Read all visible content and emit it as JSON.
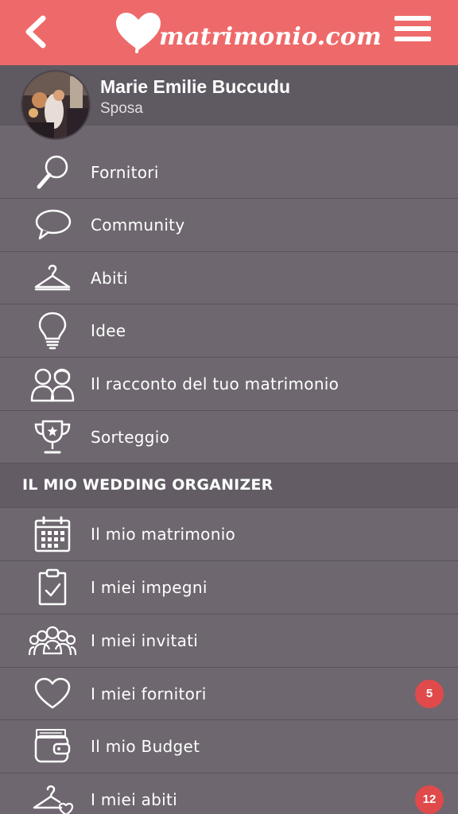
{
  "header": {
    "logo_text": "matrimonio.com",
    "colors": {
      "bar": "#ee6a6a",
      "menu_bg": "#6e676f",
      "badge": "#e04a4a"
    }
  },
  "profile": {
    "name": "Marie Emilie Buccudu",
    "role": "Sposa"
  },
  "menu": {
    "items": [
      {
        "label": "Fornitori",
        "icon": "magnifier-icon"
      },
      {
        "label": "Community",
        "icon": "speech-bubble-icon"
      },
      {
        "label": "Abiti",
        "icon": "hanger-icon"
      },
      {
        "label": "Idee",
        "icon": "lightbulb-icon"
      },
      {
        "label": "Il racconto del tuo matrimonio",
        "icon": "couple-icon"
      },
      {
        "label": "Sorteggio",
        "icon": "trophy-icon"
      }
    ],
    "section_title": "IL MIO WEDDING ORGANIZER",
    "organizer_items": [
      {
        "label": "Il mio matrimonio",
        "icon": "calendar-icon"
      },
      {
        "label": "I miei impegni",
        "icon": "clipboard-check-icon"
      },
      {
        "label": "I miei invitati",
        "icon": "guests-icon"
      },
      {
        "label": "I miei fornitori",
        "icon": "heart-icon",
        "badge": "5"
      },
      {
        "label": "Il mio Budget",
        "icon": "wallet-icon"
      },
      {
        "label": "I miei abiti",
        "icon": "hanger-heart-icon",
        "badge": "12"
      }
    ]
  }
}
